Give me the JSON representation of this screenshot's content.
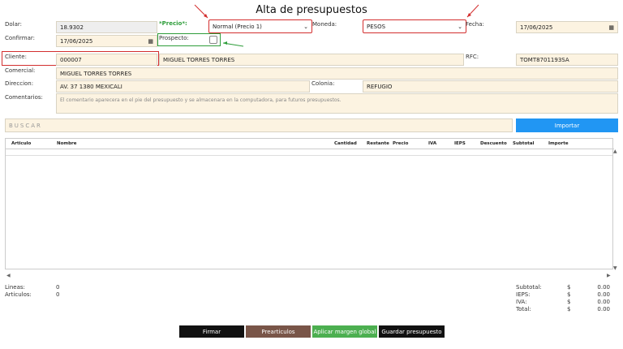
{
  "page": {
    "title": "Alta de presupuestos"
  },
  "form": {
    "dolar_label": "Dolar:",
    "dolar_value": "18.9302",
    "precio_label": "*Precio*:",
    "precio_value": "Normal (Precio 1)",
    "moneda_label": "Moneda:",
    "moneda_value": "PESOS",
    "fecha_label": "Fecha:",
    "fecha_value": "17/06/2025",
    "confirmar_label": "Confirmar:",
    "confirmar_value": "17/06/2025",
    "prospecto_label": "Prospecto:",
    "cliente_label": "Cliente:",
    "cliente_code": "000007",
    "cliente_name": "MIGUEL TORRES TORRES",
    "rfc_label": "RFC:",
    "rfc_value": "TOMT8701193SA",
    "comercial_label": "Comercial:",
    "comercial_value": "MIGUEL TORRES TORRES",
    "direccion_label": "Direccion:",
    "direccion_value": "AV. 37 1380 MEXICALI",
    "colonia_label": "Colonia:",
    "colonia_value": "REFUGIO",
    "comentarios_label": "Comentarios:",
    "comentarios_placeholder": "El comentario aparecera en el pie del presupuesto y se almacenara en la computadora, para futuros presupuestos."
  },
  "search": {
    "placeholder": "BUSCAR",
    "import_label": "Importar"
  },
  "table": {
    "headers": [
      "Articulo",
      "Nombre",
      "Cantidad",
      "Restante",
      "Precio",
      "IVA",
      "IEPS",
      "Descuento",
      "Subtotal",
      "Importe"
    ]
  },
  "summary": {
    "lineas_label": "Lineas:",
    "lineas_value": "0",
    "articulos_label": "Articulos:",
    "articulos_value": "0",
    "subtotal_label": "Subtotal:",
    "ieps_label": "IEPS:",
    "iva_label": "IVA:",
    "total_label": "Total:",
    "currency": "$",
    "subtotal_value": "0.00",
    "ieps_value": "0.00",
    "iva_value": "0.00",
    "total_value": "0.00"
  },
  "buttons": {
    "firmar": "Firmar",
    "prearticulos": "Prearticulos",
    "margen": "Aplicar margen global",
    "guardar": "Guardar presupuesto"
  },
  "colors": {
    "field_bg": "#fcf3e1",
    "annotation_red": "#d32f2f",
    "annotation_green": "#2e9d3a",
    "import_blue": "#2196f3",
    "btn_black": "#111111",
    "btn_brown": "#795548",
    "btn_green": "#4caf50"
  }
}
